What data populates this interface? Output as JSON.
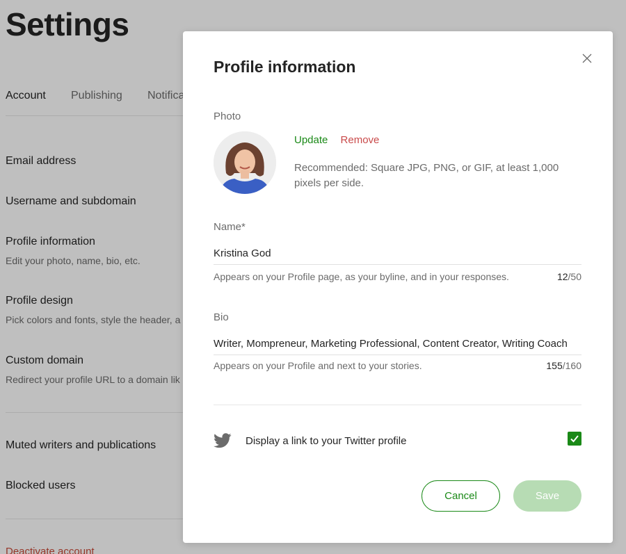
{
  "background": {
    "title": "Settings",
    "tabs": [
      "Account",
      "Publishing",
      "Notifica"
    ],
    "items": [
      {
        "label": "Email address",
        "sub": ""
      },
      {
        "label": "Username and subdomain",
        "sub": ""
      },
      {
        "label": "Profile information",
        "sub": "Edit your photo, name, bio, etc."
      },
      {
        "label": "Profile design",
        "sub": "Pick colors and fonts, style the header, a"
      },
      {
        "label": "Custom domain",
        "sub": "Redirect your profile URL to a domain lik"
      },
      {
        "label": "Muted writers and publications",
        "sub": ""
      },
      {
        "label": "Blocked users",
        "sub": ""
      }
    ],
    "deactivate": "Deactivate account"
  },
  "modal": {
    "title": "Profile information",
    "photo": {
      "label": "Photo",
      "update": "Update",
      "remove": "Remove",
      "hint": "Recommended: Square JPG, PNG, or GIF, at least 1,000 pixels per side."
    },
    "name": {
      "label": "Name*",
      "value": "Kristina God",
      "hint": "Appears on your Profile page, as your byline, and in your responses.",
      "count": "12",
      "max": "/50"
    },
    "bio": {
      "label": "Bio",
      "value": "Writer, Mompreneur, Marketing Professional, Content Creator, Writing Coach",
      "hint": "Appears on your Profile and next to your stories.",
      "count": "155",
      "max": "/160"
    },
    "twitter": {
      "label": "Display a link to your Twitter profile",
      "checked": true
    },
    "buttons": {
      "cancel": "Cancel",
      "save": "Save"
    }
  },
  "colors": {
    "accent": "#1a8917",
    "danger": "#c94a4a",
    "save_disabled": "#b7dcb4"
  }
}
